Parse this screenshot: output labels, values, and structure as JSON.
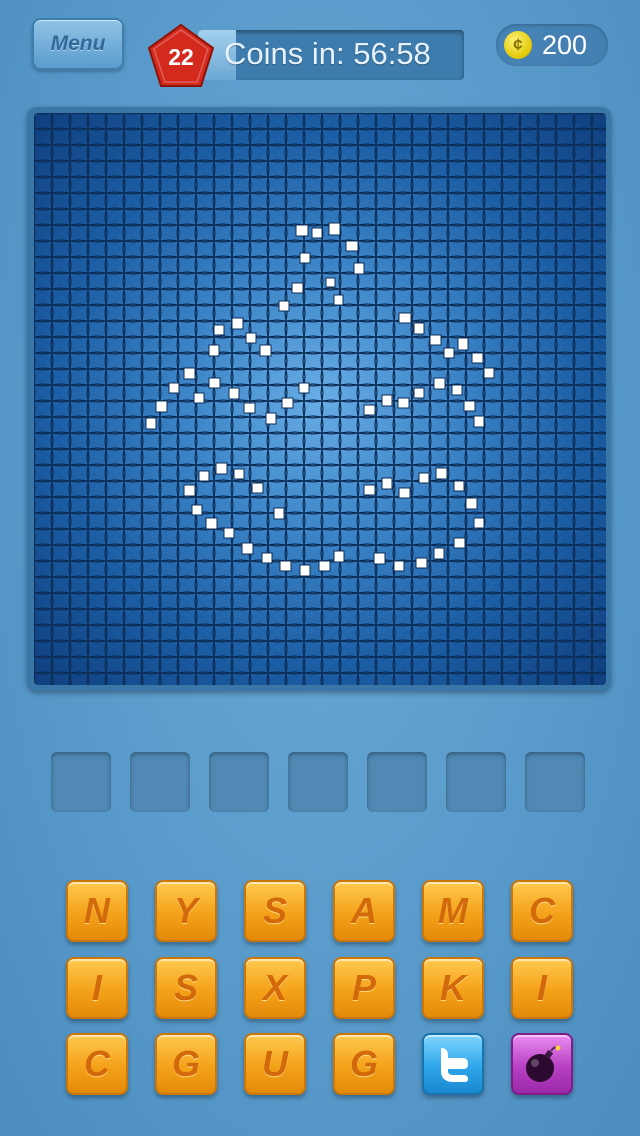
{
  "header": {
    "menu_label": "Menu",
    "level": "22",
    "timer_text": "Coins in: 56:58",
    "coin_count": "200",
    "coin_symbol": "¢"
  },
  "puzzle": {
    "icon": "tractor-mosaic-image"
  },
  "answer_slots": 7,
  "letters": {
    "row1": [
      "N",
      "Y",
      "S",
      "A",
      "M",
      "C"
    ],
    "row2": [
      "I",
      "S",
      "X",
      "P",
      "K",
      "I"
    ],
    "row3": [
      "C",
      "G",
      "U",
      "G"
    ]
  },
  "powerups": {
    "share_icon": "twitter-icon",
    "remove_icon": "bomb-icon"
  },
  "colors": {
    "tile": "#f4a21a",
    "tile_text": "#d2690b",
    "level_badge": "#d42a1e",
    "background": "#5a9dcc"
  }
}
